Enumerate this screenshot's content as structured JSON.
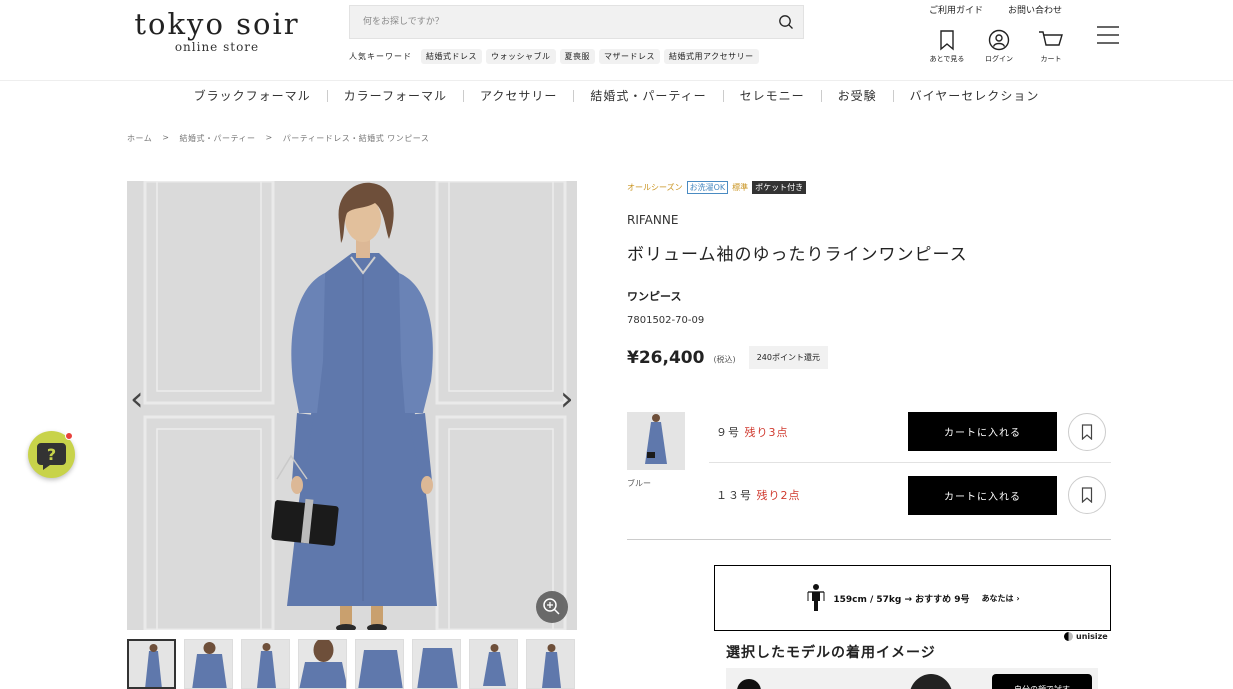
{
  "header": {
    "logo_main": "tokyo soir",
    "logo_sub": "online store",
    "search_placeholder": "何をお探しですか？",
    "keyword_label": "人気キーワード",
    "keywords": [
      "結婚式ドレス",
      "ウォッシャブル",
      "夏喪服",
      "マザードレス",
      "結婚式用アクセサリー"
    ],
    "top_links": [
      "ご利用ガイド",
      "お問い合わせ"
    ],
    "icons": [
      {
        "name": "bookmark-icon",
        "label": "あとで見る"
      },
      {
        "name": "user-icon",
        "label": "ログイン"
      },
      {
        "name": "cart-icon",
        "label": "カート"
      }
    ]
  },
  "nav": [
    "ブラックフォーマル",
    "カラーフォーマル",
    "アクセサリー",
    "結婚式・パーティー",
    "セレモニー",
    "お受験",
    "バイヤーセレクション"
  ],
  "breadcrumb": [
    "ホーム",
    ">",
    "結婚式・パーティー",
    ">",
    "パーティードレス・結婚式 ワンピース"
  ],
  "gallery": {
    "prev": "‹",
    "next": "›"
  },
  "product": {
    "badges": [
      "オールシーズン",
      "お洗濯OK",
      "標準",
      "ポケット付き"
    ],
    "brand": "RIFANNE",
    "title": "ボリューム袖のゆったりラインワンピース",
    "category": "ワンピース",
    "code": "7801502-70-09",
    "price": "¥26,400",
    "tax": "(税込)",
    "points": "240ポイント還元",
    "color": "ブルー",
    "sizes": [
      {
        "size": "９号",
        "stock": "残り3点",
        "cart_label": "カートに入れる"
      },
      {
        "size": "１３号",
        "stock": "残り2点",
        "cart_label": "カートに入れる"
      }
    ]
  },
  "unisize": {
    "text": "159cm / 57kg → おすすめ 9号",
    "you": "あなたは ›",
    "logo": "unisize"
  },
  "model": {
    "heading": "選択したモデルの着用イメージ",
    "button": "自分の顔で試す"
  },
  "colors": {
    "dress": "#5f78ac",
    "stock_red": "#d03a2f",
    "help": "#c8d34a"
  }
}
